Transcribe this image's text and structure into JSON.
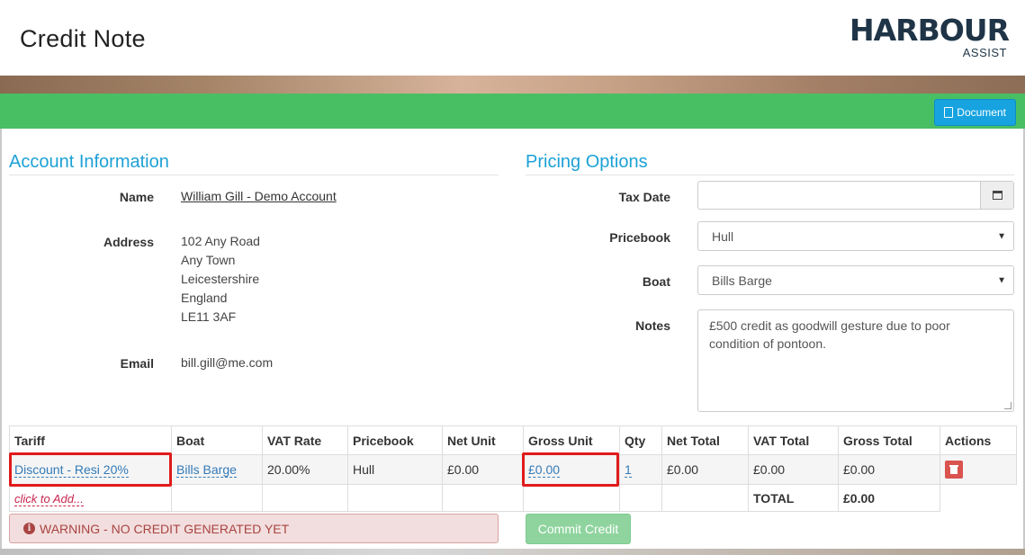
{
  "header": {
    "title": "Credit Note",
    "logo_main": "HARBOUR",
    "logo_sub": "ASSIST"
  },
  "toolbar": {
    "document_label": "Document",
    "document_icon": "pdf-file-icon"
  },
  "account": {
    "section_title": "Account Information",
    "name_label": "Name",
    "name_value": "William Gill - Demo Account",
    "address_label": "Address",
    "address_lines": [
      "102 Any Road",
      "Any Town",
      "Leicestershire",
      "England",
      "LE11 3AF"
    ],
    "email_label": "Email",
    "email_value": "bill.gill@me.com"
  },
  "pricing": {
    "section_title": "Pricing Options",
    "tax_date_label": "Tax Date",
    "tax_date_value": "",
    "pricebook_label": "Pricebook",
    "pricebook_value": "Hull",
    "boat_label": "Boat",
    "boat_value": "Bills Barge",
    "notes_label": "Notes",
    "notes_value": "£500 credit as goodwill gesture due to poor condition of pontoon."
  },
  "table": {
    "headers": [
      "Tariff",
      "Boat",
      "VAT Rate",
      "Pricebook",
      "Net Unit",
      "Gross Unit",
      "Qty",
      "Net Total",
      "VAT Total",
      "Gross Total",
      "Actions"
    ],
    "row": {
      "tariff": "Discount - Resi 20%",
      "boat": "Bills Barge",
      "vat_rate": "20.00%",
      "pricebook": "Hull",
      "net_unit": "£0.00",
      "gross_unit": "£0.00",
      "qty": "1",
      "net_total": "£0.00",
      "vat_total": "£0.00",
      "gross_total": "£0.00"
    },
    "add_label": "click to Add...",
    "total_label": "TOTAL",
    "total_value": "£0.00"
  },
  "warning_text": "WARNING - NO CREDIT GENERATED YET",
  "commit_label": "Commit Credit",
  "colors": {
    "accent": "#1da1d6",
    "green_bar": "#49bf64",
    "highlight": "#e01b1b",
    "warning_bg": "#f2dede",
    "delete": "#d9534f"
  }
}
